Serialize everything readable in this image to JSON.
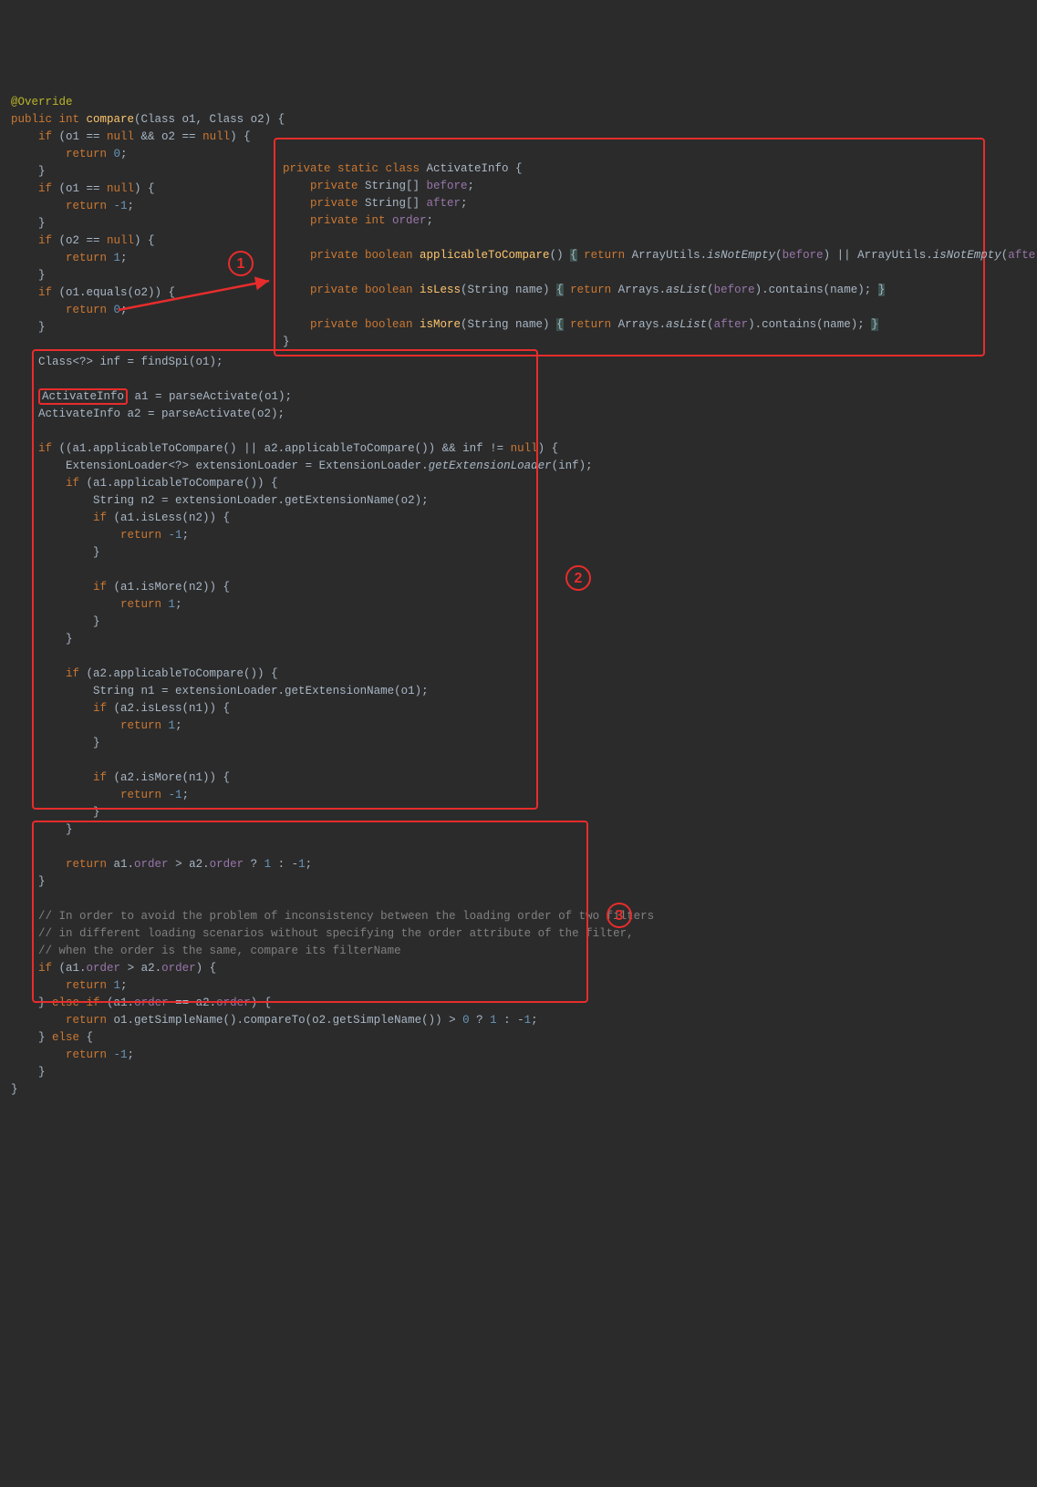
{
  "callouts": {
    "c1": "1",
    "c2": "2",
    "c3": "3"
  },
  "code": {
    "l1a": "@Override",
    "l2a": "public ",
    "l2b": "int ",
    "l2c": "compare",
    "l2d": "(Class o1, Class o2) {",
    "l3a": "    if ",
    "l3b": "(o1 == ",
    "l3c": "null ",
    "l3d": "&& o2 == ",
    "l3e": "null",
    "l3f": ") {",
    "l4a": "        return ",
    "l4b": "0",
    "l4c": ";",
    "l5": "    }",
    "l6a": "    if ",
    "l6b": "(o1 == ",
    "l6c": "null",
    "l6d": ") {",
    "l7a": "        return ",
    "l7b": "-1",
    "l7c": ";",
    "l8": "    }",
    "l9a": "    if ",
    "l9b": "(o2 == ",
    "l9c": "null",
    "l9d": ") {",
    "l10a": "        return ",
    "l10b": "1",
    "l10c": ";",
    "l11": "    }",
    "l12a": "    if ",
    "l12b": "(o1.equals(o2)) {",
    "l13a": "        return ",
    "l13b": "0",
    "l13c": ";",
    "l14": "    }",
    "l15a": "    Class<?> inf = findSpi(o1);",
    "l16a": "    ",
    "l16b": "ActivateInfo",
    "l16c": " a1 = parseActivate(o1);",
    "l17a": "    ActivateInfo a2 = parseActivate(o2);"
  },
  "box1": {
    "b1a": "private static class ",
    "b1b": "ActivateInfo {",
    "b2a": "    private ",
    "b2b": "String[] ",
    "b2c": "before",
    "b2d": ";",
    "b3a": "    private ",
    "b3b": "String[] ",
    "b3c": "after",
    "b3d": ";",
    "b4a": "    private int ",
    "b4b": "order",
    "b4c": ";",
    "b5a": "    private boolean ",
    "b5b": "applicableToCompare",
    "b5c": "() ",
    "b5obr": "{",
    "b5d": " return ",
    "b5e": "ArrayUtils.",
    "b5f": "isNotEmpty",
    "b5g": "(",
    "b5h": "before",
    "b5i": ") || ArrayUtils.",
    "b5j": "isNotEmpty",
    "b5k": "(",
    "b5l": "after",
    "b5m": "); ",
    "b5cbr": "}",
    "b6a": "    private boolean ",
    "b6b": "isLess",
    "b6c": "(String name) ",
    "b6obr": "{",
    "b6d": " return ",
    "b6e": "Arrays.",
    "b6f": "asList",
    "b6g": "(",
    "b6h": "before",
    "b6i": ").contains(name); ",
    "b6cbr": "}",
    "b7a": "    private boolean ",
    "b7b": "isMore",
    "b7c": "(String name) ",
    "b7obr": "{",
    "b7d": " return ",
    "b7e": "Arrays.",
    "b7f": "asList",
    "b7g": "(",
    "b7h": "after",
    "b7i": ").contains(name); ",
    "b7cbr": "}",
    "b8": "}"
  },
  "box2": {
    "c1a": "if ",
    "c1b": "((a1.applicableToCompare() || a2.applicableToCompare()) && inf != ",
    "c1c": "null",
    "c1d": ") {",
    "c2a": "    ExtensionLoader<?> extensionLoader = ExtensionLoader.",
    "c2b": "getExtensionLoader",
    "c2c": "(inf);",
    "c3a": "    if ",
    "c3b": "(a1.applicableToCompare()) {",
    "c4a": "        String n2 = extensionLoader.getExtensionName(o2);",
    "c5a": "        if ",
    "c5b": "(a1.isLess(n2)) {",
    "c6a": "            return ",
    "c6b": "-1",
    "c6c": ";",
    "c7": "        }",
    "c8": "",
    "c9a": "        if ",
    "c9b": "(a1.isMore(n2)) {",
    "c10a": "            return ",
    "c10b": "1",
    "c10c": ";",
    "c11": "        }",
    "c12": "    }",
    "c13": "",
    "c14a": "    if ",
    "c14b": "(a2.applicableToCompare()) {",
    "c15a": "        String n1 = extensionLoader.getExtensionName(o1);",
    "c16a": "        if ",
    "c16b": "(a2.isLess(n1)) {",
    "c17a": "            return ",
    "c17b": "1",
    "c17c": ";",
    "c18": "        }",
    "c19": "",
    "c20a": "        if ",
    "c20b": "(a2.isMore(n1)) {",
    "c21a": "            return ",
    "c21b": "-1",
    "c21c": ";",
    "c22": "        }",
    "c23": "    }",
    "c24": "",
    "c25a": "    return ",
    "c25b": "a1.",
    "c25c": "order ",
    "c25d": "> a2.",
    "c25e": "order ",
    "c25f": "? ",
    "c25g": "1 ",
    "c25h": ": -",
    "c25i": "1",
    "c25j": ";",
    "c26": "}"
  },
  "box3": {
    "d1": "// In order to avoid the problem of inconsistency between the loading order of two filters",
    "d2": "// in different loading scenarios without specifying the order attribute of the filter,",
    "d3": "// when the order is the same, compare its filterName",
    "d4a": "if ",
    "d4b": "(a1.",
    "d4c": "order ",
    "d4d": "> a2.",
    "d4e": "order",
    "d4f": ") {",
    "d5a": "    return ",
    "d5b": "1",
    "d5c": ";",
    "d6a": "} ",
    "d6b": "else if ",
    "d6c": "(a1.",
    "d6d": "order ",
    "d6e": "== a2.",
    "d6f": "order",
    "d6g": ") {",
    "d7a": "    return ",
    "d7b": "o1.getSimpleName().compareTo(o2.getSimpleName()) > ",
    "d7c": "0 ",
    "d7d": "? ",
    "d7e": "1 ",
    "d7f": ": -",
    "d7g": "1",
    "d7h": ";",
    "d8a": "} ",
    "d8b": "else ",
    "d8c": "{",
    "d9a": "    return ",
    "d9b": "-1",
    "d9c": ";",
    "d10": "}"
  },
  "tail": {
    "t1": "}"
  }
}
